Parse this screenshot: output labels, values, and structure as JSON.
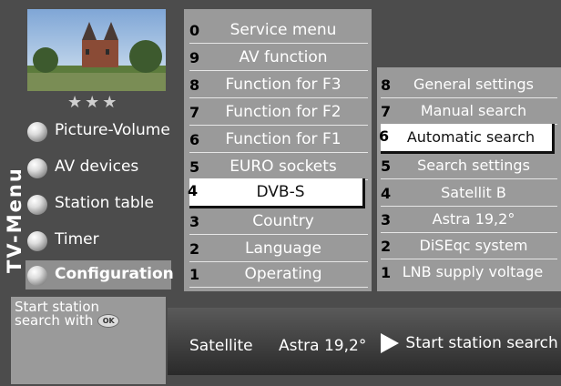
{
  "side_title": "TV-Menu",
  "stars": "★★★",
  "nav": [
    {
      "label": "Picture-Volume"
    },
    {
      "label": "AV devices"
    },
    {
      "label": "Station table"
    },
    {
      "label": "Timer"
    },
    {
      "label": "Configuration",
      "active": true
    }
  ],
  "middle_menu": [
    {
      "num": "0",
      "label": "Service menu"
    },
    {
      "num": "9",
      "label": "AV function"
    },
    {
      "num": "8",
      "label": "Function for F3"
    },
    {
      "num": "7",
      "label": "Function for F2"
    },
    {
      "num": "6",
      "label": "Function for F1"
    },
    {
      "num": "5",
      "label": "EURO sockets"
    },
    {
      "num": "4",
      "label": "DVB-S",
      "selected": true
    },
    {
      "num": "3",
      "label": "Country"
    },
    {
      "num": "2",
      "label": "Language"
    },
    {
      "num": "1",
      "label": "Operating"
    }
  ],
  "right_menu": [
    {
      "num": "8",
      "label": "General settings"
    },
    {
      "num": "7",
      "label": "Manual search"
    },
    {
      "num": "6",
      "label": "Automatic search",
      "selected": true
    },
    {
      "num": "5",
      "label": "Search settings"
    },
    {
      "num": "4",
      "label": "Satellit B"
    },
    {
      "num": "3",
      "label": "Astra 19,2°"
    },
    {
      "num": "2",
      "label": "DiSEqc system"
    },
    {
      "num": "1",
      "label": "LNB supply voltage"
    }
  ],
  "hint": {
    "line1": "Start station",
    "line2": "search with",
    "ok_icon": "OK"
  },
  "status": {
    "label": "Satellite",
    "value": "Astra 19,2°",
    "action": "Start station search"
  },
  "colors": {
    "panel_dark": "#4c4c4c",
    "panel_gray": "#9a9a9a",
    "text_white": "#ffffff",
    "highlight": "#ffffff"
  }
}
